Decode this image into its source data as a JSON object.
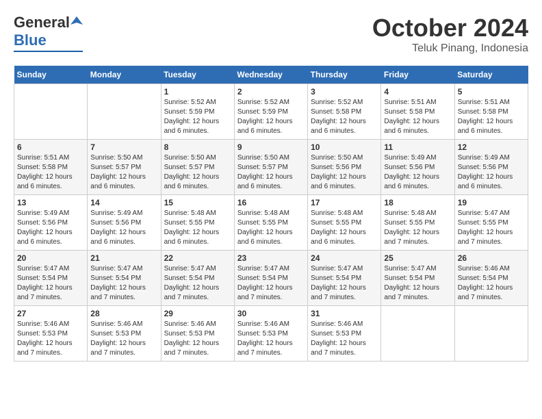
{
  "logo": {
    "general": "General",
    "blue": "Blue"
  },
  "title": "October 2024",
  "location": "Teluk Pinang, Indonesia",
  "weekdays": [
    "Sunday",
    "Monday",
    "Tuesday",
    "Wednesday",
    "Thursday",
    "Friday",
    "Saturday"
  ],
  "weeks": [
    [
      {
        "day": "",
        "info": ""
      },
      {
        "day": "",
        "info": ""
      },
      {
        "day": "1",
        "info": "Sunrise: 5:52 AM\nSunset: 5:59 PM\nDaylight: 12 hours and 6 minutes."
      },
      {
        "day": "2",
        "info": "Sunrise: 5:52 AM\nSunset: 5:59 PM\nDaylight: 12 hours and 6 minutes."
      },
      {
        "day": "3",
        "info": "Sunrise: 5:52 AM\nSunset: 5:58 PM\nDaylight: 12 hours and 6 minutes."
      },
      {
        "day": "4",
        "info": "Sunrise: 5:51 AM\nSunset: 5:58 PM\nDaylight: 12 hours and 6 minutes."
      },
      {
        "day": "5",
        "info": "Sunrise: 5:51 AM\nSunset: 5:58 PM\nDaylight: 12 hours and 6 minutes."
      }
    ],
    [
      {
        "day": "6",
        "info": "Sunrise: 5:51 AM\nSunset: 5:58 PM\nDaylight: 12 hours and 6 minutes."
      },
      {
        "day": "7",
        "info": "Sunrise: 5:50 AM\nSunset: 5:57 PM\nDaylight: 12 hours and 6 minutes."
      },
      {
        "day": "8",
        "info": "Sunrise: 5:50 AM\nSunset: 5:57 PM\nDaylight: 12 hours and 6 minutes."
      },
      {
        "day": "9",
        "info": "Sunrise: 5:50 AM\nSunset: 5:57 PM\nDaylight: 12 hours and 6 minutes."
      },
      {
        "day": "10",
        "info": "Sunrise: 5:50 AM\nSunset: 5:56 PM\nDaylight: 12 hours and 6 minutes."
      },
      {
        "day": "11",
        "info": "Sunrise: 5:49 AM\nSunset: 5:56 PM\nDaylight: 12 hours and 6 minutes."
      },
      {
        "day": "12",
        "info": "Sunrise: 5:49 AM\nSunset: 5:56 PM\nDaylight: 12 hours and 6 minutes."
      }
    ],
    [
      {
        "day": "13",
        "info": "Sunrise: 5:49 AM\nSunset: 5:56 PM\nDaylight: 12 hours and 6 minutes."
      },
      {
        "day": "14",
        "info": "Sunrise: 5:49 AM\nSunset: 5:56 PM\nDaylight: 12 hours and 6 minutes."
      },
      {
        "day": "15",
        "info": "Sunrise: 5:48 AM\nSunset: 5:55 PM\nDaylight: 12 hours and 6 minutes."
      },
      {
        "day": "16",
        "info": "Sunrise: 5:48 AM\nSunset: 5:55 PM\nDaylight: 12 hours and 6 minutes."
      },
      {
        "day": "17",
        "info": "Sunrise: 5:48 AM\nSunset: 5:55 PM\nDaylight: 12 hours and 6 minutes."
      },
      {
        "day": "18",
        "info": "Sunrise: 5:48 AM\nSunset: 5:55 PM\nDaylight: 12 hours and 7 minutes."
      },
      {
        "day": "19",
        "info": "Sunrise: 5:47 AM\nSunset: 5:55 PM\nDaylight: 12 hours and 7 minutes."
      }
    ],
    [
      {
        "day": "20",
        "info": "Sunrise: 5:47 AM\nSunset: 5:54 PM\nDaylight: 12 hours and 7 minutes."
      },
      {
        "day": "21",
        "info": "Sunrise: 5:47 AM\nSunset: 5:54 PM\nDaylight: 12 hours and 7 minutes."
      },
      {
        "day": "22",
        "info": "Sunrise: 5:47 AM\nSunset: 5:54 PM\nDaylight: 12 hours and 7 minutes."
      },
      {
        "day": "23",
        "info": "Sunrise: 5:47 AM\nSunset: 5:54 PM\nDaylight: 12 hours and 7 minutes."
      },
      {
        "day": "24",
        "info": "Sunrise: 5:47 AM\nSunset: 5:54 PM\nDaylight: 12 hours and 7 minutes."
      },
      {
        "day": "25",
        "info": "Sunrise: 5:47 AM\nSunset: 5:54 PM\nDaylight: 12 hours and 7 minutes."
      },
      {
        "day": "26",
        "info": "Sunrise: 5:46 AM\nSunset: 5:54 PM\nDaylight: 12 hours and 7 minutes."
      }
    ],
    [
      {
        "day": "27",
        "info": "Sunrise: 5:46 AM\nSunset: 5:53 PM\nDaylight: 12 hours and 7 minutes."
      },
      {
        "day": "28",
        "info": "Sunrise: 5:46 AM\nSunset: 5:53 PM\nDaylight: 12 hours and 7 minutes."
      },
      {
        "day": "29",
        "info": "Sunrise: 5:46 AM\nSunset: 5:53 PM\nDaylight: 12 hours and 7 minutes."
      },
      {
        "day": "30",
        "info": "Sunrise: 5:46 AM\nSunset: 5:53 PM\nDaylight: 12 hours and 7 minutes."
      },
      {
        "day": "31",
        "info": "Sunrise: 5:46 AM\nSunset: 5:53 PM\nDaylight: 12 hours and 7 minutes."
      },
      {
        "day": "",
        "info": ""
      },
      {
        "day": "",
        "info": ""
      }
    ]
  ]
}
